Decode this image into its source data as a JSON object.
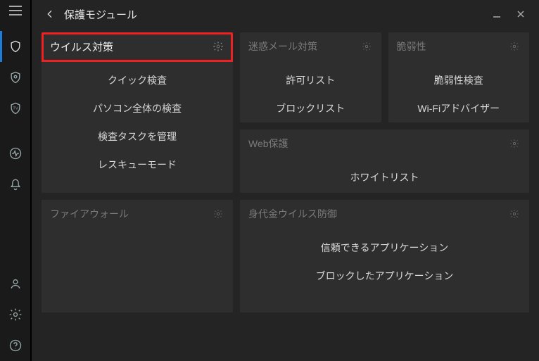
{
  "header": {
    "title": "保護モジュール"
  },
  "sidebar": {
    "items": [
      "menu",
      "shield",
      "eye",
      "tv",
      "activity",
      "bell",
      "user",
      "settings",
      "help"
    ]
  },
  "cards": {
    "antivirus": {
      "title": "ウイルス対策",
      "items": [
        "クイック検査",
        "パソコン全体の検査",
        "検査タスクを管理",
        "レスキューモード"
      ]
    },
    "antispam": {
      "title": "迷惑メール対策",
      "items": [
        "許可リスト",
        "ブロックリスト"
      ]
    },
    "vulnerability": {
      "title": "脆弱性",
      "items": [
        "脆弱性検査",
        "Wi-Fiアドバイザー"
      ]
    },
    "web": {
      "title": "Web保護",
      "items": [
        "ホワイトリスト"
      ]
    },
    "firewall": {
      "title": "ファイアウォール",
      "items": []
    },
    "ransom": {
      "title": "身代金ウイルス防御",
      "items": [
        "信頼できるアプリケーション",
        "ブロックしたアプリケーション"
      ]
    }
  }
}
